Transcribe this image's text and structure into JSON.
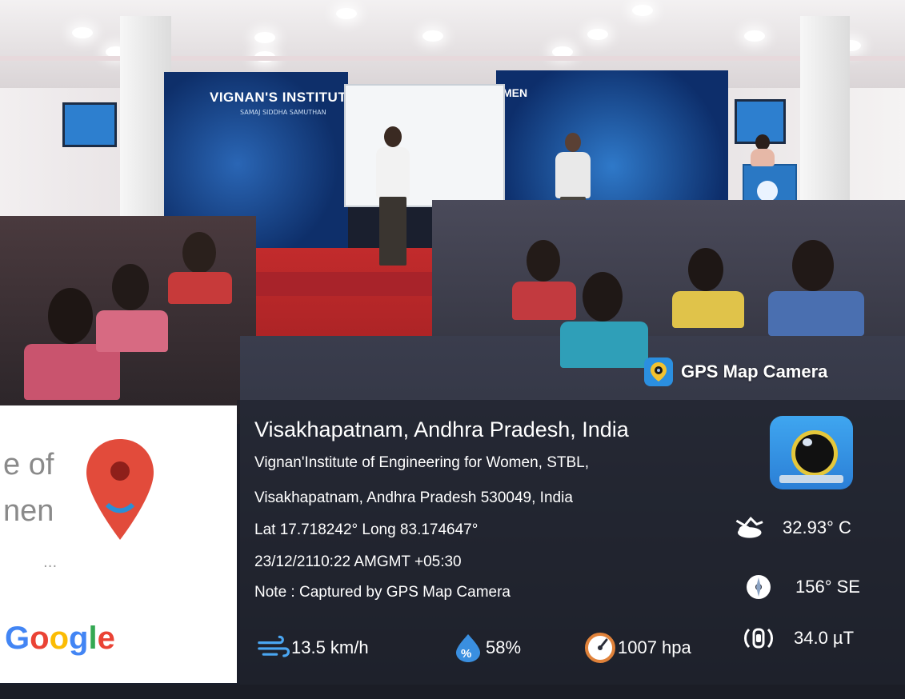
{
  "scene": {
    "backdrop_text_left": "VIGNAN'S INSTITUTE",
    "backdrop_subtext_left": "SAMAJ SIDDHA SAMUTHAN",
    "backdrop_text_right": "MEN"
  },
  "badge": {
    "icon": "map-pin-camera-icon",
    "label": "GPS Map Camera"
  },
  "location": {
    "title": "Visakhapatnam, Andhra Pradesh, India",
    "address_line1": "Vignan'Institute of Engineering for Women, STBL,",
    "address_line2": "Visakhapatnam, Andhra Pradesh 530049, India",
    "coords": "Lat 17.718242° Long 83.174647°",
    "datetime": "23/12/2110:22 AMGMT +05:30",
    "note": "Note : Captured by GPS Map Camera"
  },
  "metrics": {
    "temperature": "32.93° C",
    "compass": "156° SE",
    "magnetic": "34.0 µT",
    "wind": "13.5 km/h",
    "humidity": "58%",
    "pressure": "1007 hpa"
  },
  "map": {
    "partial_line1": "e of",
    "partial_line2": "nen",
    "ellipsis": "...",
    "google": [
      "G",
      "o",
      "o",
      "g",
      "l",
      "e"
    ]
  },
  "colors": {
    "accent_blue": "#2b8fe0",
    "pin_red": "#e24b3b",
    "google_blue": "#4285F4",
    "google_red": "#EA4335",
    "google_yellow": "#FBBC05",
    "google_green": "#34A853"
  }
}
